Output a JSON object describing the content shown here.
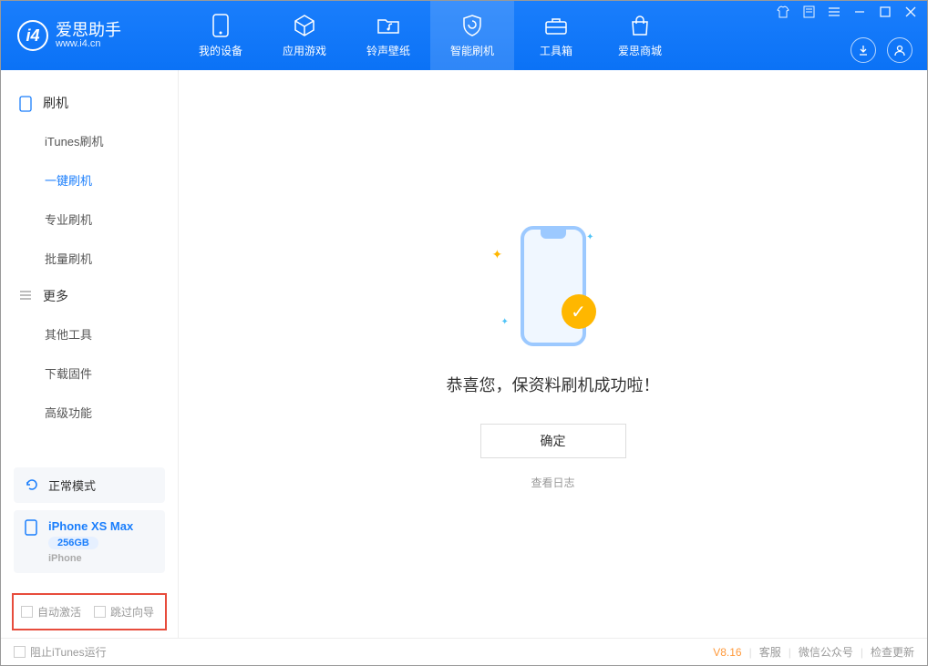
{
  "app": {
    "title": "爱思助手",
    "subtitle": "www.i4.cn"
  },
  "nav": {
    "device": "我的设备",
    "apps": "应用游戏",
    "ring": "铃声壁纸",
    "flash": "智能刷机",
    "tools": "工具箱",
    "store": "爱思商城"
  },
  "sidebar": {
    "section_flash": "刷机",
    "items_flash": {
      "itunes": "iTunes刷机",
      "oneclick": "一键刷机",
      "pro": "专业刷机",
      "batch": "批量刷机"
    },
    "section_more": "更多",
    "items_more": {
      "other": "其他工具",
      "firmware": "下载固件",
      "advanced": "高级功能"
    }
  },
  "device": {
    "mode": "正常模式",
    "name": "iPhone XS Max",
    "storage": "256GB",
    "type": "iPhone"
  },
  "options": {
    "auto_activate": "自动激活",
    "skip_guide": "跳过向导"
  },
  "main": {
    "success_msg": "恭喜您，保资料刷机成功啦！",
    "confirm": "确定",
    "view_log": "查看日志"
  },
  "status": {
    "block_itunes": "阻止iTunes运行",
    "version": "V8.16",
    "support": "客服",
    "wechat": "微信公众号",
    "update": "检查更新"
  }
}
